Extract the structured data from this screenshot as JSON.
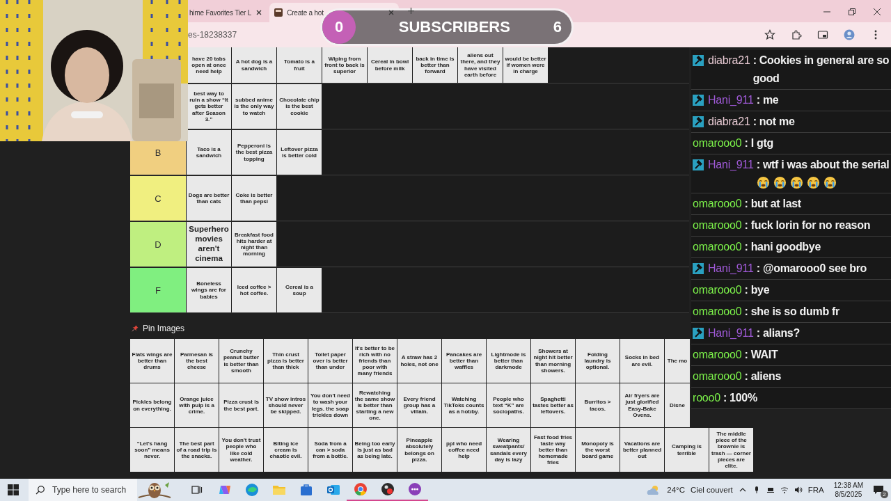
{
  "browser": {
    "tabs": [
      {
        "title": "hime Favorites Tier L",
        "selected": false
      },
      {
        "title": "Create a hot",
        "selected": true
      }
    ],
    "new_tab": "+",
    "address": "es-18238337"
  },
  "subscriber_goal": {
    "current": "0",
    "label": "SUBSCRIBERS",
    "target": "6"
  },
  "tier_list": {
    "rows": [
      {
        "items": [
          "have 20 tabs open at once need help",
          "A hot dog is a sandwich",
          "Tomato is a fruit",
          "Wiping from front to back is superior",
          "Cereal in bowl before milk",
          "back in time is better than forward",
          "aliens out there, and they have visited earth before",
          "would be better if women were in charge"
        ]
      },
      {
        "items": [
          "best way to ruin a show “It gets better after Season 3.”",
          "subbed anime is the only way to watch",
          "Chocolate chip is the best cookie"
        ]
      },
      {
        "label": "B",
        "color": "#f0cf80",
        "items": [
          "Taco is a sandwich",
          "Pepperoni is the best pizza topping",
          "Leftover pizza is better cold"
        ]
      },
      {
        "label": "C",
        "color": "#f0ef80",
        "items": [
          "Dogs are better than cats",
          "Coke is better than pepsi"
        ]
      },
      {
        "label": "D",
        "color": "#bfef80",
        "items": [
          {
            "text": "Superhero movies aren't cinema",
            "kind": "large"
          },
          {
            "text": "Breakfast food hits harder at night than morning",
            "kind": "normal"
          }
        ]
      },
      {
        "label": "F",
        "color": "#80ef80",
        "items": [
          "Boneless wings are for babies",
          "Iced coffee > hot coffee.",
          "Cereal is a soup"
        ]
      }
    ]
  },
  "pin_images": {
    "title": "Pin Images",
    "rows": [
      [
        "Flats wings are better than drums",
        "Parmesan is the best cheese",
        "Crunchy peanut butter is better than smooth",
        "Thin crust pizza is better than thick",
        "Toilet paper over is better than under",
        "It's better to be rich with no friends than poor with many friends",
        "A straw has 2 holes, not one",
        "Pancakes are better than waffles",
        "Lightmode is better than darkmode",
        "Showers at night hit better than morning showers.",
        "Folding laundry is optional.",
        "Socks in bed are evil.",
        "The mo"
      ],
      [
        "Pickles belong on everything.",
        "Orange juice with pulp is a crime.",
        "Pizza crust is the best part.",
        "TV show intros should never be skipped.",
        "You don't need to wash your legs. the soap trickles down",
        "Rewatching the same show is better than starting a new one.",
        "Every friend group has a villain.",
        "Watching TikToks counts as a hobby.",
        "People who text “K” are sociopaths.",
        "Spaghetti tastes better as leftovers.",
        "Burritos > tacos.",
        "Air fryers are just glorified Easy-Bake Ovens.",
        "Disne"
      ],
      [
        "“Let's hang soon” means never.",
        "The best part of a road trip is the snacks.",
        "You don't trust people who like cold weather.",
        "Biting ice cream is chaotic evil.",
        "Soda from a can > soda from a bottle.",
        "Being too early is just as bad as being late.",
        "Pineapple absolutely belongs on pizza.",
        "ppl who need coffee need help",
        "Wearing sweatpants/ sandals every day is lazy",
        "Fast food fries taste way better than homemade fries",
        "Monopoly is the worst board game",
        "Vacations are better planned out",
        "Camping is terrible",
        "The middle piece of the brownie is trash — corner pieces are elite."
      ]
    ]
  },
  "chat": {
    "messages": [
      {
        "user": "diabra21",
        "color": "#e6c9d2",
        "moderator": true,
        "text": ": Cookies in general are so good"
      },
      {
        "user": "Hani_911",
        "color": "#a05ad8",
        "moderator": true,
        "text": ": me"
      },
      {
        "user": "diabra21",
        "color": "#e6c9d2",
        "moderator": true,
        "text": ": not me"
      },
      {
        "user": "omarooo0",
        "color": "#7cf24a",
        "moderator": false,
        "text": ": I gtg"
      },
      {
        "user": "Hani_911",
        "color": "#a05ad8",
        "moderator": true,
        "text": ": wtf i was about the serial",
        "emotes": [
          {
            "kind": "crying"
          },
          {
            "kind": "crying"
          },
          {
            "kind": "crying"
          },
          {
            "kind": "crying"
          },
          {
            "kind": "crying"
          }
        ]
      },
      {
        "user": "omarooo0",
        "color": "#7cf24a",
        "moderator": false,
        "text": ": but at last"
      },
      {
        "user": "omarooo0",
        "color": "#7cf24a",
        "moderator": false,
        "text": ": fuck lorin for no reason"
      },
      {
        "user": "omarooo0",
        "color": "#7cf24a",
        "moderator": false,
        "text": ": hani goodbye"
      },
      {
        "user": "Hani_911",
        "color": "#a05ad8",
        "moderator": true,
        "text": ": @omarooo0 see bro"
      },
      {
        "user": "omarooo0",
        "color": "#7cf24a",
        "moderator": false,
        "text": ": bye"
      },
      {
        "user": "omarooo0",
        "color": "#7cf24a",
        "moderator": false,
        "text": ": she is so dumb fr"
      },
      {
        "user": "Hani_911",
        "color": "#a05ad8",
        "moderator": true,
        "text": ": alians?"
      },
      {
        "user": "omarooo0",
        "color": "#7cf24a",
        "moderator": false,
        "text": ": WAIT"
      },
      {
        "user": "omarooo0",
        "color": "#7cf24a",
        "moderator": false,
        "text": ": aliens"
      },
      {
        "user": "rooo0",
        "color": "#7cf24a",
        "moderator": false,
        "text": ": 100%"
      }
    ]
  },
  "taskbar": {
    "search": {
      "placeholder": "Type here to search"
    },
    "apps": [
      {
        "kind": "copilot",
        "running": false
      },
      {
        "kind": "edge",
        "running": false
      },
      {
        "kind": "folder",
        "running": false
      },
      {
        "kind": "store",
        "running": false
      },
      {
        "kind": "mail",
        "running": false
      },
      {
        "kind": "chrome",
        "running": true
      },
      {
        "kind": "record",
        "running": true
      },
      {
        "kind": "chat",
        "running": true
      }
    ],
    "weather": {
      "temperature": "24°C",
      "condition": "Ciel couvert"
    },
    "language": "FRA",
    "time": "12:38 AM",
    "date": "8/5/2025",
    "notifications": "2"
  }
}
